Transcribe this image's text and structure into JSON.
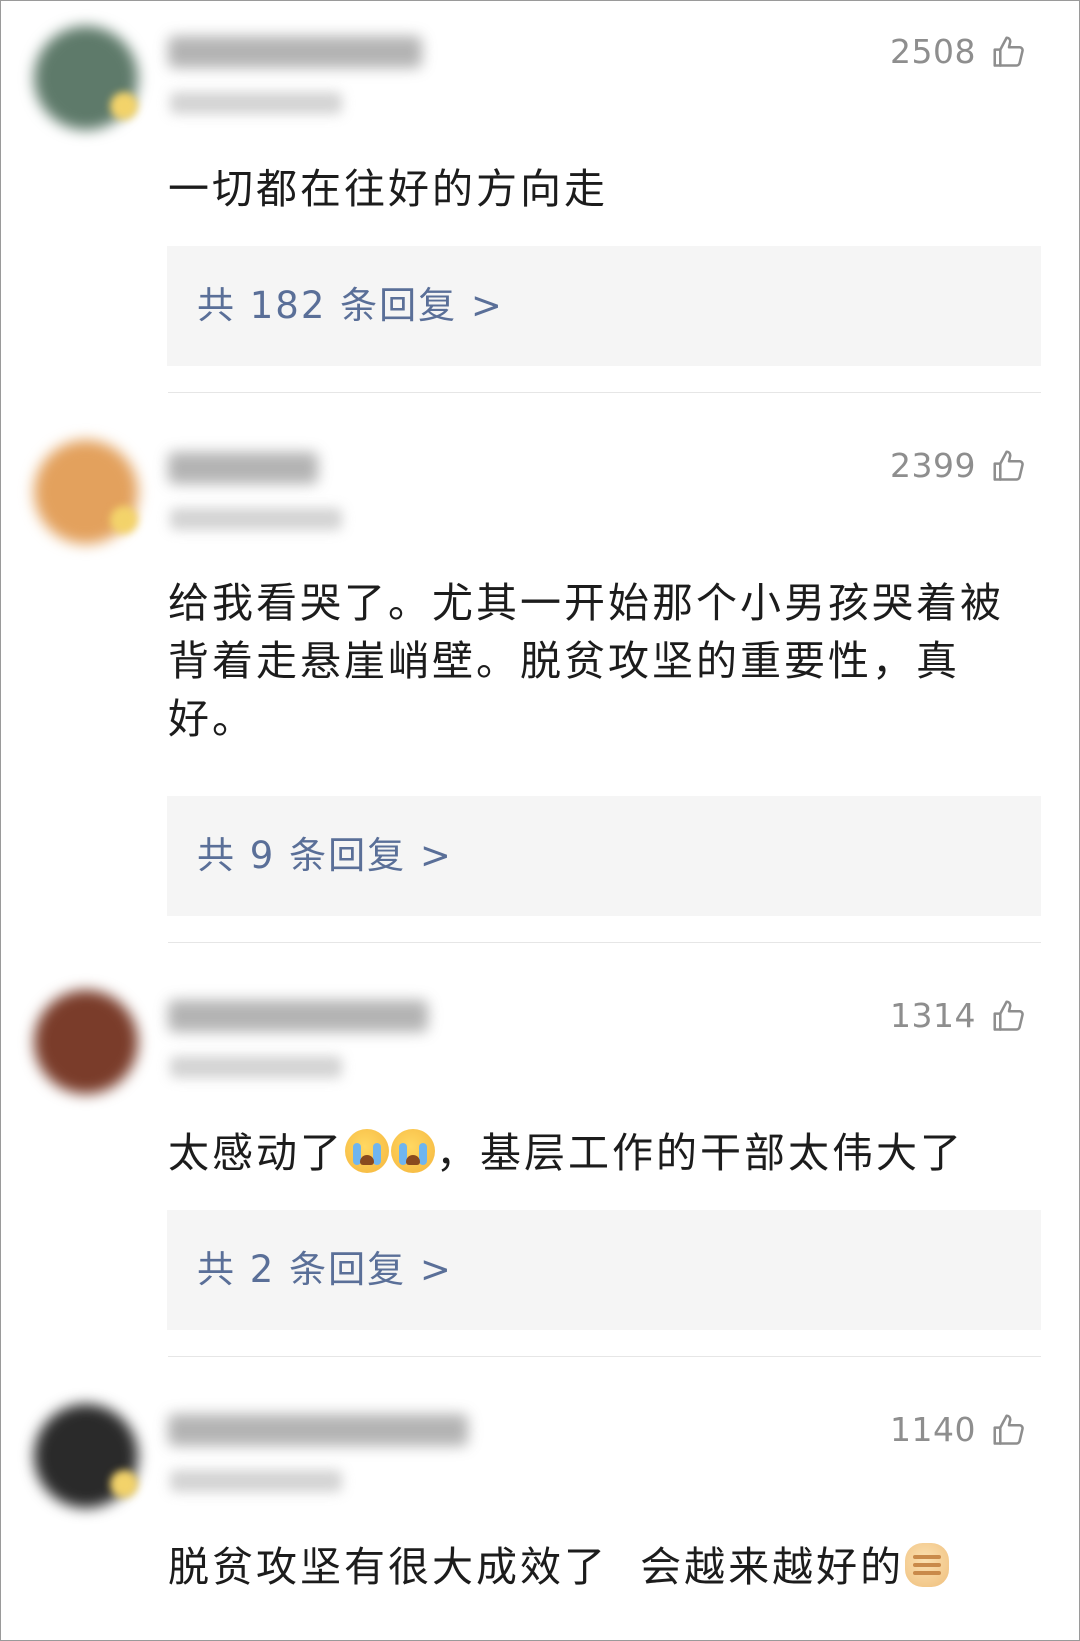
{
  "comments": [
    {
      "likes": "2508",
      "text": "一切都在往好的方向走",
      "replies": "共 182 条回复 >",
      "avatar_color": "#5e7a6a",
      "name_width": 254
    },
    {
      "likes": "2399",
      "text": "给我看哭了。尤其一开始那个小男孩哭着被背着走悬崖峭壁。脱贫攻坚的重要性，真好。",
      "replies": "共 9 条回复 >",
      "avatar_color": "#e3a15d",
      "name_width": 150
    },
    {
      "likes": "1314",
      "text_before": "太感动了",
      "text_after": "，基层工作的干部太伟大了",
      "emoji": [
        "loudly-crying-face",
        "loudly-crying-face"
      ],
      "replies": "共 2 条回复 >",
      "avatar_color": "#7a3c2a",
      "name_width": 260
    },
    {
      "likes": "1140",
      "text_before": "脱贫攻坚有很大成效了  会越来越好的",
      "emoji": [
        "raised-fist"
      ],
      "avatar_color": "#2a2a2a",
      "name_width": 300
    }
  ],
  "colors": {
    "reply_link": "#5a6f98",
    "likes_text": "#8e8e8e",
    "reply_box_bg": "#f5f5f5",
    "content_text": "#1c1c1c"
  },
  "icons": {
    "like": "thumbs-up-outline-icon"
  }
}
